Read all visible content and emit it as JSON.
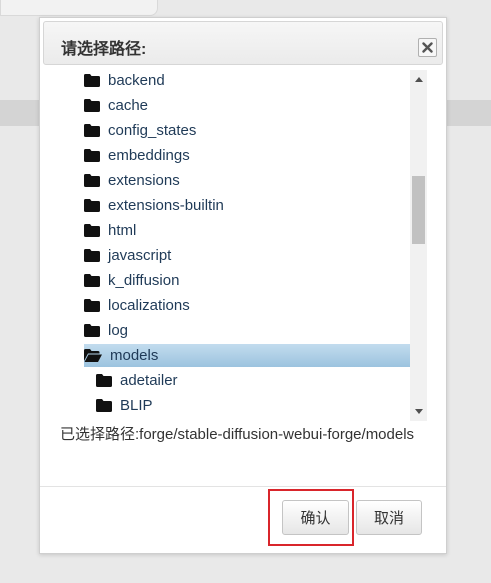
{
  "dialog": {
    "title": "请选择路径:",
    "close_icon": "close-icon",
    "selected_path_label": "已选择路径:",
    "selected_path_value": "forge/stable-diffusion-webui-forge/models",
    "confirm_label": "确认",
    "cancel_label": "取消",
    "highlight_color": "#d9252b",
    "selected_row_color": "#a9cbe3"
  },
  "tree": {
    "items": [
      {
        "label": "backend",
        "icon": "folder-icon"
      },
      {
        "label": "cache",
        "icon": "folder-icon"
      },
      {
        "label": "config_states",
        "icon": "folder-icon"
      },
      {
        "label": "embeddings",
        "icon": "folder-icon"
      },
      {
        "label": "extensions",
        "icon": "folder-icon"
      },
      {
        "label": "extensions-builtin",
        "icon": "folder-icon"
      },
      {
        "label": "html",
        "icon": "folder-icon"
      },
      {
        "label": "javascript",
        "icon": "folder-icon"
      },
      {
        "label": "k_diffusion",
        "icon": "folder-icon"
      },
      {
        "label": "localizations",
        "icon": "folder-icon"
      },
      {
        "label": "log",
        "icon": "folder-icon"
      },
      {
        "label": "models",
        "icon": "folder-open-icon",
        "selected": true
      },
      {
        "label": "adetailer",
        "icon": "folder-icon",
        "child": true
      },
      {
        "label": "BLIP",
        "icon": "folder-icon",
        "child": true
      }
    ]
  }
}
